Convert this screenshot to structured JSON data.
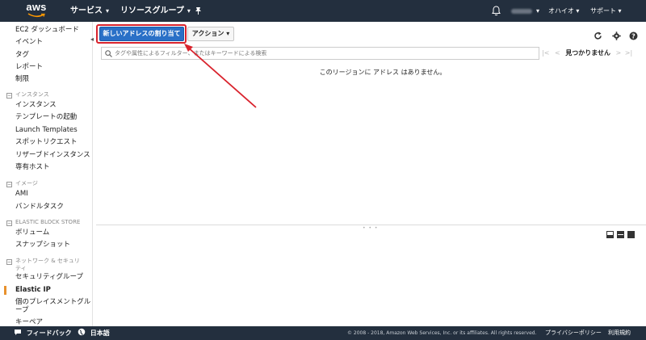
{
  "topbar": {
    "logo": "aws",
    "services": "サービス",
    "resource_groups": "リソースグループ",
    "region": "オハイオ",
    "support": "サポート",
    "chevron": "▾"
  },
  "sidebar": {
    "items": [
      {
        "label": "EC2 ダッシュボード",
        "type": "item"
      },
      {
        "label": "イベント",
        "type": "item"
      },
      {
        "label": "タグ",
        "type": "item"
      },
      {
        "label": "レポート",
        "type": "item"
      },
      {
        "label": "制限",
        "type": "item"
      },
      {
        "label": "インスタンス",
        "type": "head"
      },
      {
        "label": "インスタンス",
        "type": "item"
      },
      {
        "label": "テンプレートの起動",
        "type": "item"
      },
      {
        "label": "Launch Templates",
        "type": "item"
      },
      {
        "label": "スポットリクエスト",
        "type": "item"
      },
      {
        "label": "リザーブドインスタンス",
        "type": "item"
      },
      {
        "label": "専有ホスト",
        "type": "item"
      },
      {
        "label": "イメージ",
        "type": "head"
      },
      {
        "label": "AMI",
        "type": "item"
      },
      {
        "label": "バンドルタスク",
        "type": "item"
      },
      {
        "label": "ELASTIC BLOCK STORE",
        "type": "head"
      },
      {
        "label": "ボリューム",
        "type": "item"
      },
      {
        "label": "スナップショット",
        "type": "item"
      },
      {
        "label": "ネットワーク & セキュリ",
        "type": "head"
      },
      {
        "label": "ティ",
        "type": "head2"
      },
      {
        "label": "セキュリティグループ",
        "type": "item"
      },
      {
        "label": "Elastic IP",
        "type": "item",
        "active": true
      },
      {
        "label": "個のプレイスメントグル",
        "type": "item"
      },
      {
        "label": "ープ",
        "type": "item"
      },
      {
        "label": "キーペア",
        "type": "item"
      }
    ],
    "collapse": "◂"
  },
  "toolbar": {
    "allocate_label": "新しいアドレスの割り当て",
    "actions_label": "アクション"
  },
  "search": {
    "placeholder": "タグや属性によるフィルター、またはキーワードによる検索"
  },
  "pager": {
    "first": "|<",
    "prev": "<",
    "status": "見つかりません",
    "next": ">",
    "last": ">|"
  },
  "main": {
    "empty_message": "このリージョンに アドレス はありません。"
  },
  "footer": {
    "feedback": "フィードバック",
    "language": "日本語",
    "copyright": "© 2008 - 2018, Amazon Web Services, Inc. or its affiliates. All rights reserved.",
    "privacy": "プライバシーポリシー",
    "terms": "利用規約"
  },
  "colors": {
    "nav_bg": "#232f3e",
    "primary_button": "#2a70c7",
    "highlight": "#d9232d",
    "active_marker": "#e8912d"
  }
}
